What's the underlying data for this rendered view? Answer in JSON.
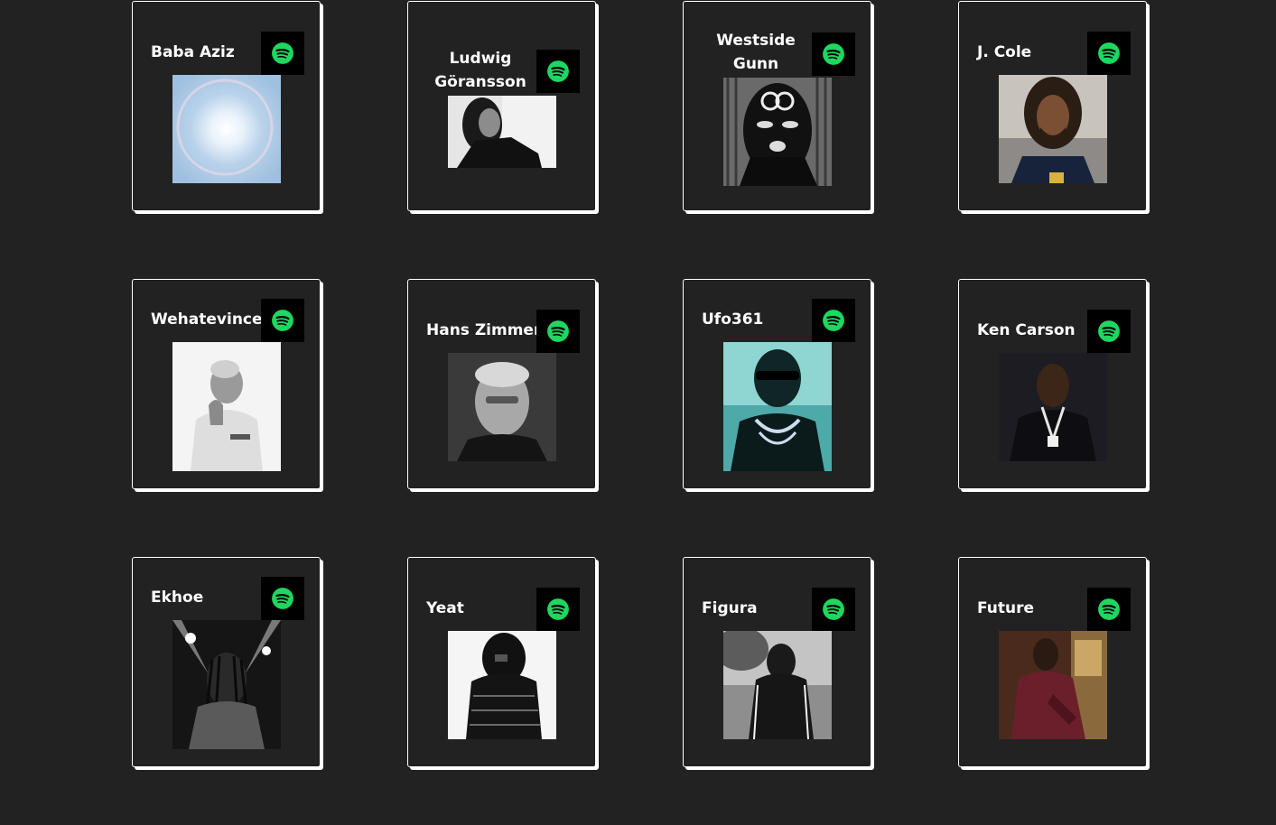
{
  "colors": {
    "page_background": "#222222",
    "card_border": "#ffffff",
    "spotify_green": "#1ed760",
    "spotify_badge": "#000000"
  },
  "spotify_icon": "spotify-logo-icon",
  "artists": [
    {
      "name": "Baba Aziz",
      "photo": "sun-halo-photo"
    },
    {
      "name": "Ludwig Göransson",
      "photo": "portrait-photo"
    },
    {
      "name": "Westside Gunn",
      "photo": "ski-mask-photo"
    },
    {
      "name": "J. Cole",
      "photo": "portrait-photo"
    },
    {
      "name": "Wehatevince",
      "photo": "portrait-photo"
    },
    {
      "name": "Hans Zimmer",
      "photo": "portrait-photo"
    },
    {
      "name": "Ufo361",
      "photo": "portrait-photo"
    },
    {
      "name": "Ken Carson",
      "photo": "portrait-photo"
    },
    {
      "name": "Ekhoe",
      "photo": "concert-photo"
    },
    {
      "name": "Yeat",
      "photo": "portrait-photo"
    },
    {
      "name": "Figura",
      "photo": "portrait-photo"
    },
    {
      "name": "Future",
      "photo": "portrait-photo"
    }
  ]
}
